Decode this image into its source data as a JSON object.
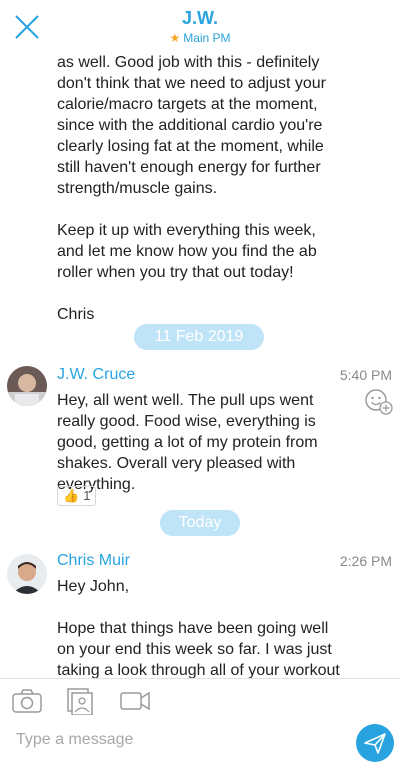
{
  "header": {
    "title": "J.W.",
    "subtitle": "Main PM",
    "star": "★",
    "accent": "#29a3e0",
    "star_color": "#f5a623"
  },
  "messages": [
    {
      "id": "m1",
      "text": "as well. Good job with this - definitely\ndon't think that we need to adjust your\ncalorie/macro targets at the moment,\nsince with the additional cardio you're\nclearly losing fat at the moment, while\nstill haven't enough energy for further\nstrength/muscle gains.\n\nKeep it up with everything this week,\nand let me know how you find the ab\nroller when you try that out today!\n\nChris"
    },
    {
      "id": "m2",
      "sender": "J.W. Cruce",
      "time": "5:40 PM",
      "text": "Hey, all went well. The pull ups went\nreally good. Food wise, everything is\ngood, getting a lot of my protein from\nshakes. Overall very pleased with\neverything.",
      "reaction": {
        "emoji": "👍",
        "count": "1"
      }
    },
    {
      "id": "m3",
      "sender": "Chris Muir",
      "time": "2:26 PM",
      "text": "Hey John,\n\nHope that things have been going well\non your end this week so far. I was just\ntaking a look through all of your workout"
    }
  ],
  "date_separators": [
    "11 Feb 2019",
    "Today"
  ],
  "composer": {
    "placeholder": "Type a message",
    "icons": [
      "camera-icon",
      "gallery-icon",
      "video-icon",
      "send-icon"
    ]
  }
}
